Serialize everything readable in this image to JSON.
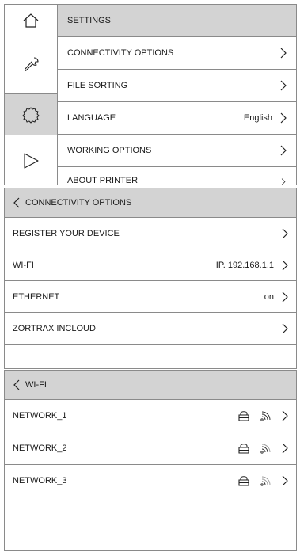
{
  "settings": {
    "title": "SETTINGS",
    "sidebar": [
      {
        "icon": "home-icon",
        "active": false
      },
      {
        "icon": "wrench-icon",
        "active": false
      },
      {
        "icon": "gear-icon",
        "active": true
      },
      {
        "icon": "play-icon",
        "active": false
      }
    ],
    "items": [
      {
        "label": "CONNECTIVITY OPTIONS",
        "value": ""
      },
      {
        "label": "FILE SORTING",
        "value": ""
      },
      {
        "label": "LANGUAGE",
        "value": "English"
      },
      {
        "label": "WORKING OPTIONS",
        "value": ""
      },
      {
        "label": "ABOUT PRINTER",
        "value": ""
      }
    ]
  },
  "connectivity": {
    "title": "CONNECTIVITY OPTIONS",
    "items": [
      {
        "label": "REGISTER YOUR DEVICE",
        "value": ""
      },
      {
        "label": "WI-FI",
        "value": "IP. 192.168.1.1"
      },
      {
        "label": "ETHERNET",
        "value": "on"
      },
      {
        "label": "ZORTRAX INCLOUD",
        "value": ""
      }
    ]
  },
  "wifi": {
    "title": "WI-FI",
    "networks": [
      {
        "name": "NETWORK_1",
        "locked": true
      },
      {
        "name": "NETWORK_2",
        "locked": true
      },
      {
        "name": "NETWORK_3",
        "locked": true
      }
    ]
  }
}
